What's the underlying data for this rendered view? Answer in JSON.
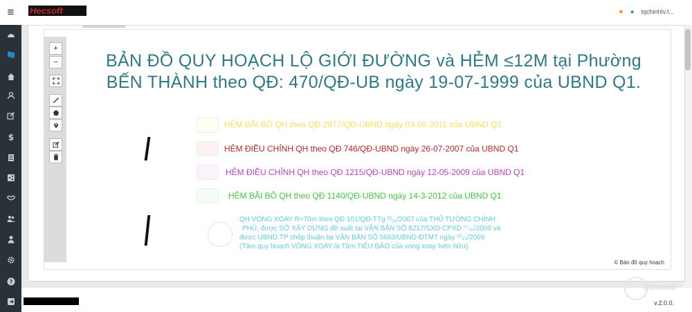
{
  "app": {
    "logo_text": "Hecsoft",
    "user": "tqchinhlv.t...",
    "version": "v.2.0.0."
  },
  "sidebar": {
    "menu_glyph": "≡",
    "icons": [
      "dashboard-icon",
      "map-icon",
      "home-icon",
      "user-icon",
      "edit-icon",
      "dollar-icon",
      "file-icon",
      "share-icon",
      "handshake-icon",
      "users-icon",
      "person-icon",
      "gear-icon",
      "help-icon",
      "logout-icon"
    ]
  },
  "map": {
    "title_line1": "BẢN ĐỒ QUY HOẠCH LỘ GIỚI ĐƯỜNG và HẺM ≤12M tại Phường",
    "title_line2": "BẾN THÀNH theo QĐ: 470/QĐ-UB ngày 19-07-1999 của UBND Q1.",
    "attribution": "© Bản đồ quy hoạch",
    "zoom_in": "+",
    "zoom_out": "−",
    "legend": [
      {
        "text": "HẺM BÃI BỎ QH  theo QĐ 2977/QĐ-UBND  ngày 03-06-2011 của UBND Q1",
        "color": "#f2e25b"
      },
      {
        "text": "HẺM ĐIỀU CHỈNH QH theo QĐ 746/QĐ-UBND ngày 26-07-2007 của UBND Q1",
        "color": "#b8262e"
      },
      {
        "text": "HẺM ĐIỀU CHỈNH QH theo QĐ 1215/QĐ-UBND ngày 12-05-2009 của UBND Q1",
        "color": "#c13fc0"
      },
      {
        "text": "HẺM BÃI BỎ QH theo QĐ 1140/QĐ-UBND ngày 14-3-2012 của UBND Q1",
        "color": "#3ec93e"
      }
    ],
    "note_lines": [
      "QH VÒNG XOAY R=70m theo QĐ 101/QĐ-TTg ²²₀₁/2007 của THỦ TƯỚNG CHÍNH",
      "PHỦ, được SỞ XÂY DỰNG đề xuất tại VĂN BẢN SỐ 8217/SXD-CPXD ⁰⁷₁₀/2009  và",
      "được UBND.TP chấp thuận tại VĂN BẢN SỐ 5663/UBND-ĐTMT ngày ²⁹₁₀/2009",
      "(Tâm quy hoạch VÒNG XOAY là Tâm TIỂU ĐẢO của vòng xoay hiện hữu)."
    ],
    "watermark": "Cafeland"
  },
  "colors": {
    "sidebar_bg": "#2b3138",
    "title": "#2c7a86",
    "note": "#5ccddd"
  }
}
